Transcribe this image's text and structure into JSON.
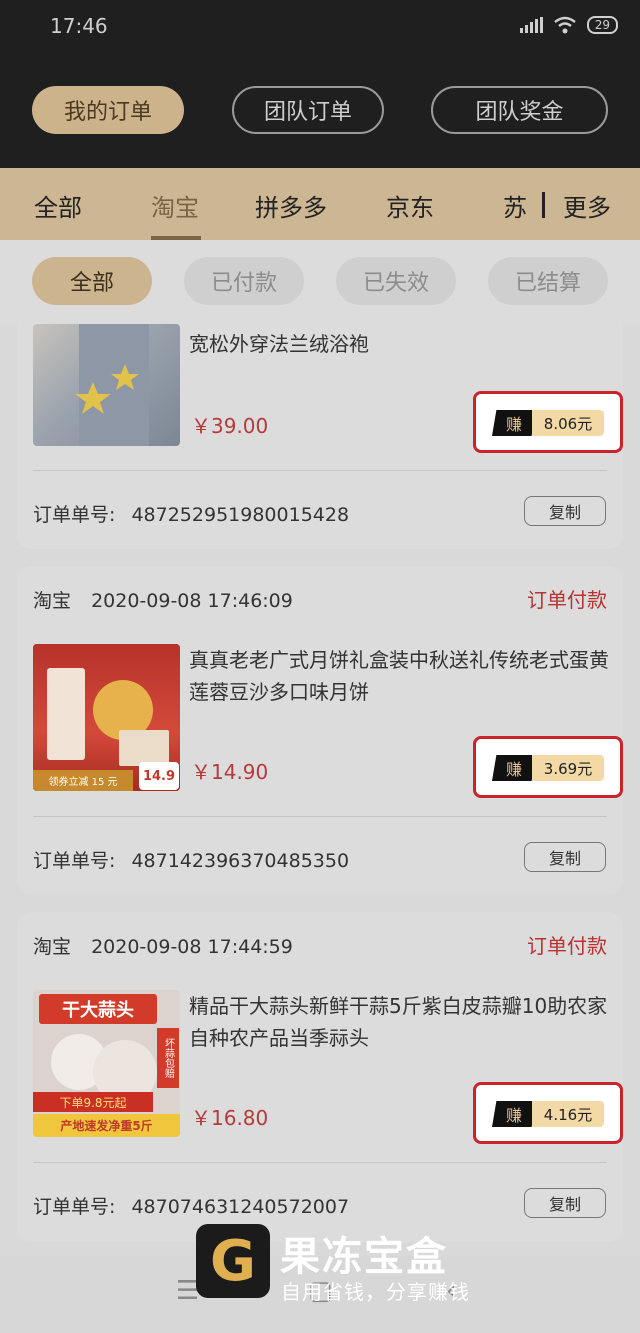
{
  "status_bar": {
    "time": "17:46",
    "battery": "29"
  },
  "header": {
    "segments": [
      {
        "label": "我的订单"
      },
      {
        "label": "团队订单"
      },
      {
        "label": "团队奖金"
      }
    ]
  },
  "platform_tabs": [
    "全部",
    "淘宝",
    "拼多多",
    "京东",
    "苏",
    "更多"
  ],
  "filters": [
    "全部",
    "已付款",
    "已失效",
    "已结算"
  ],
  "orders": [
    {
      "title": "宽松外穿法兰绒浴袍",
      "price": "￥39.00",
      "earn_label": "赚",
      "earn": "8.06元",
      "order_label": "订单单号:",
      "order_no": "487252951980015428",
      "copy": "复制"
    },
    {
      "source": "淘宝",
      "time": "2020-09-08 17:46:09",
      "status": "订单付款",
      "title": "真真老老广式月饼礼盒装中秋送礼传统老式蛋黄莲蓉豆沙多口味月饼",
      "price": "￥14.90",
      "earn_label": "赚",
      "earn": "3.69元",
      "order_label": "订单单号:",
      "order_no": "487142396370485350",
      "copy": "复制",
      "thumb_text": "领券立减 15 元",
      "thumb_price": "14.9"
    },
    {
      "source": "淘宝",
      "time": "2020-09-08 17:44:59",
      "status": "订单付款",
      "title": "精品干大蒜头新鲜干蒜5斤紫白皮蒜瓣10助农家自种农产品当季祘头",
      "price": "￥16.80",
      "earn_label": "赚",
      "earn": "4.16元",
      "order_label": "订单单号:",
      "order_no": "487074631240572007",
      "copy": "复制",
      "thumb_banner": "干大蒜头",
      "thumb_promo": "下单9.8元起",
      "thumb_ship": "产地速发净重5斤",
      "thumb_badge": "坏蒜包赔"
    }
  ],
  "watermark": {
    "logo_letter": "G",
    "title": "果冻宝盒",
    "subtitle": "自用省钱，分享赚钱"
  },
  "colors": {
    "accent": "#cdb38b",
    "price_red": "#b73a3a",
    "highlight_border": "#c8242a"
  }
}
